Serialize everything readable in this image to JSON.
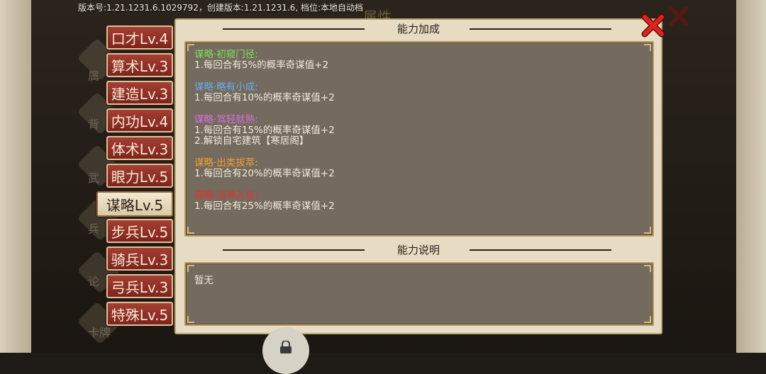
{
  "version_info": "版本号:1.21.1231.6.1029792，创建版本:1.21.1231.6, 档位:本地自动档",
  "background_title": "属性",
  "tabs": [
    {
      "label": "口才Lv.4"
    },
    {
      "label": "算术Lv.3"
    },
    {
      "label": "建造Lv.3"
    },
    {
      "label": "内功Lv.4"
    },
    {
      "label": "体术Lv.3"
    },
    {
      "label": "眼力Lv.5"
    },
    {
      "label": "谋略Lv.5"
    },
    {
      "label": "步兵Lv.5"
    },
    {
      "label": "骑兵Lv.3"
    },
    {
      "label": "弓兵Lv.3"
    },
    {
      "label": "特殊Lv.5"
    }
  ],
  "active_tab_index": 6,
  "background_labels": [
    "属",
    "背",
    "武",
    "兵",
    "论",
    "卡牌"
  ],
  "dialog": {
    "bonus_title": "能力加成",
    "bonuses": [
      {
        "name": "谋略·初窥门径:",
        "color": "#7ee05a",
        "lines": [
          "1.每回合有5%的概率奇谋值+2"
        ]
      },
      {
        "name": "谋略·略有小成:",
        "color": "#66aef0",
        "lines": [
          "1.每回合有10%的概率奇谋值+2"
        ]
      },
      {
        "name": "谋略·驾轻就熟:",
        "color": "#d86ee0",
        "lines": [
          "1.每回合有15%的概率奇谋值+2",
          "2.解锁自宅建筑【寒居阁】"
        ]
      },
      {
        "name": "谋略·出类拔萃:",
        "color": "#f0a030",
        "lines": [
          "1.每回合有20%的概率奇谋值+2"
        ]
      },
      {
        "name": "谋略·出神入化:",
        "color": "#e8322a",
        "lines": [
          "1.每回合有25%的概率奇谋值+2"
        ]
      }
    ],
    "desc_title": "能力说明",
    "desc_text": "暂无"
  },
  "colors": {
    "close_red": "#e0231c",
    "panel_bg": "#746a5e",
    "dialog_bg": "#e7dcc3"
  }
}
